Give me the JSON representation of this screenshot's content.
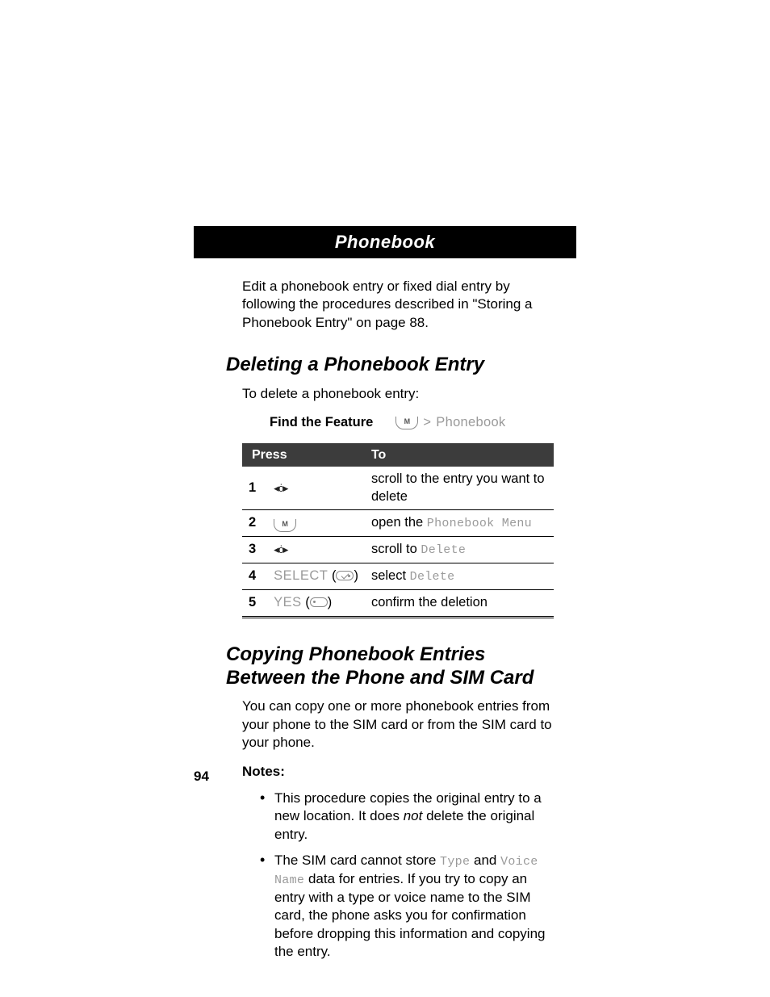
{
  "header": {
    "title": "Phonebook"
  },
  "intro": "Edit a phonebook entry or fixed dial entry by following the procedures described in \"Storing a Phonebook Entry\" on page 88.",
  "section_delete": {
    "heading": "Deleting a Phonebook Entry",
    "lead": "To delete a phonebook entry:",
    "find_feature_label": "Find the Feature",
    "find_feature_value_gt": ">",
    "find_feature_value_menu": "Phonebook",
    "table": {
      "head_press": "Press",
      "head_to": "To",
      "rows": [
        {
          "num": "1",
          "press_type": "nav",
          "press": "",
          "to_pre": "scroll to the entry you want to delete",
          "to_mono": ""
        },
        {
          "num": "2",
          "press_type": "menukey",
          "press": "",
          "to_pre": "open the ",
          "to_mono": "Phonebook Menu"
        },
        {
          "num": "3",
          "press_type": "nav",
          "press": "",
          "to_pre": "scroll to ",
          "to_mono": "Delete"
        },
        {
          "num": "4",
          "press_type": "soft-r",
          "press": "SELECT",
          "to_pre": "select ",
          "to_mono": "Delete"
        },
        {
          "num": "5",
          "press_type": "soft-l",
          "press": "YES",
          "to_pre": "confirm the deletion",
          "to_mono": ""
        }
      ]
    }
  },
  "section_copy": {
    "heading": "Copying Phonebook Entries Between the Phone and SIM Card",
    "lead": "You can copy one or more phonebook entries from your phone to the SIM card or from the SIM card to your phone.",
    "notes_label": "Notes:",
    "notes": [
      {
        "pre": "This procedure copies the original entry to a new location. It does ",
        "ital": "not",
        "post": " delete the original entry."
      },
      {
        "pre": "The SIM card cannot store ",
        "mono1": "Type",
        "mid": " and ",
        "mono2": "Voice Name",
        "post": " data for entries. If you try to copy an entry with a type or voice name to the SIM card, the phone asks you for confirmation before dropping this information and copying the entry."
      }
    ]
  },
  "page_number": "94"
}
